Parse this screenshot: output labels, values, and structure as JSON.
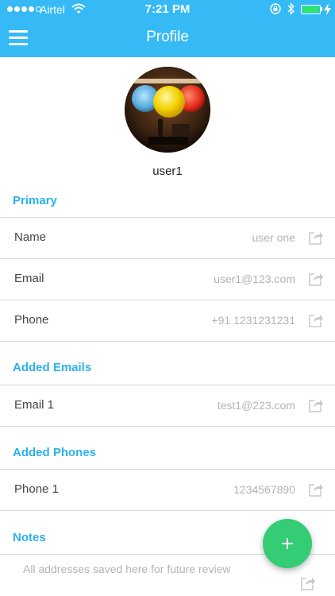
{
  "status_bar": {
    "carrier": "Airtel",
    "time": "7:21 PM"
  },
  "header": {
    "title": "Profile"
  },
  "profile": {
    "username": "user1"
  },
  "sections": {
    "primary": {
      "title": "Primary",
      "rows": [
        {
          "label": "Name",
          "value": "user one"
        },
        {
          "label": "Email",
          "value": "user1@123.com"
        },
        {
          "label": "Phone",
          "value": "+91 1231231231"
        }
      ]
    },
    "emails": {
      "title": "Added Emails",
      "rows": [
        {
          "label": "Email 1",
          "value": "test1@223.com"
        }
      ]
    },
    "phones": {
      "title": "Added Phones",
      "rows": [
        {
          "label": "Phone 1",
          "value": "1234567890"
        }
      ]
    },
    "notes": {
      "title": "Notes",
      "text": "All addresses saved here for future review"
    }
  },
  "icons": {
    "menu": "hamburger-menu-icon",
    "share": "share-icon",
    "add": "plus-icon"
  },
  "colors": {
    "header": "#35baf6",
    "section_title": "#2ab1ea",
    "fab": "#34cc74",
    "battery": "#2ee66b"
  }
}
